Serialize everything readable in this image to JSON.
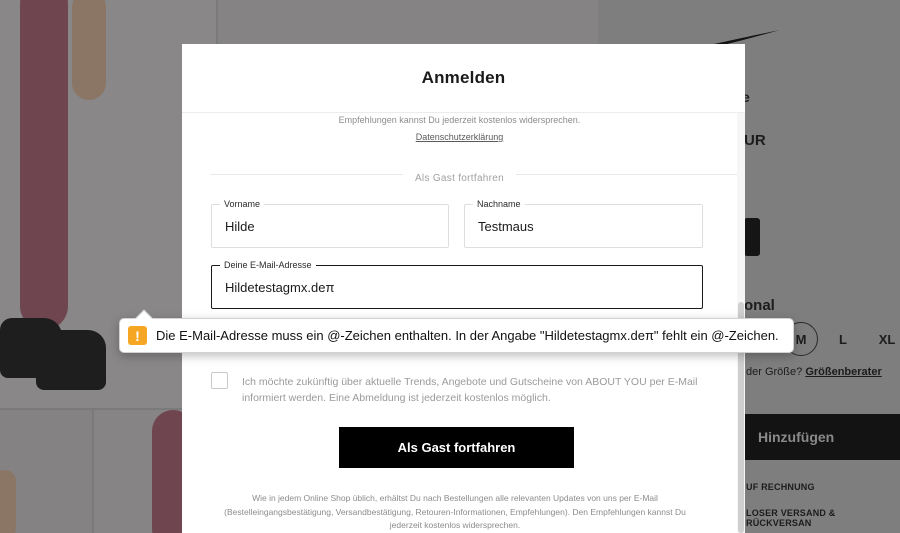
{
  "modal": {
    "title": "Anmelden",
    "top_hint": "Empfehlungen kannst Du jederzeit kostenlos widersprechen.",
    "privacy_link": "Datenschutzerklärung",
    "divider_label": "Als Gast fortfahren",
    "first_name": {
      "label": "Vorname",
      "value": "Hilde"
    },
    "last_name": {
      "label": "Nachname",
      "value": "Testmaus"
    },
    "email": {
      "label": "Deine E-Mail-Adresse",
      "value": "Hildetestagmx.deπ"
    },
    "consent_text": "Ich möchte zukünftig über aktuelle Trends, Angebote und Gutscheine von ABOUT YOU per E-Mail informiert werden. Eine Abmeldung ist jederzeit kostenlos möglich.",
    "guest_button": "Als Gast fortfahren",
    "footnote": "Wie in jedem Online Shop üblich, erhältst Du nach Bestellungen alle relevanten Updates von uns per E-Mail (Bestelleingangsbestätigung, Versandbestätigung, Retouren-Informationen, Empfehlungen). Den Empfehlungen kannst Du jederzeit kostenlos widersprechen."
  },
  "validation_tooltip": {
    "icon": "warning-icon",
    "icon_glyph": "!",
    "message": "Die E-Mail-Adresse muss ein @-Zeichen enthalten. In der Angabe \"Hildetestagmx.deπ\" fehlt ein @-Zeichen.",
    "icon_color": "#f5a623"
  },
  "background_page": {
    "fragment_1": "e",
    "fragment_2": "UR",
    "fragment_3": "onal",
    "sizes": [
      "M",
      "L",
      "XL"
    ],
    "size_hint_prefix": "der Größe?",
    "size_advisor_link": "Größenberater",
    "add_button": "Hinzufügen",
    "info_1": "UF RECHNUNG",
    "info_2": "LOSER VERSAND & RÜCKVERSAN"
  }
}
